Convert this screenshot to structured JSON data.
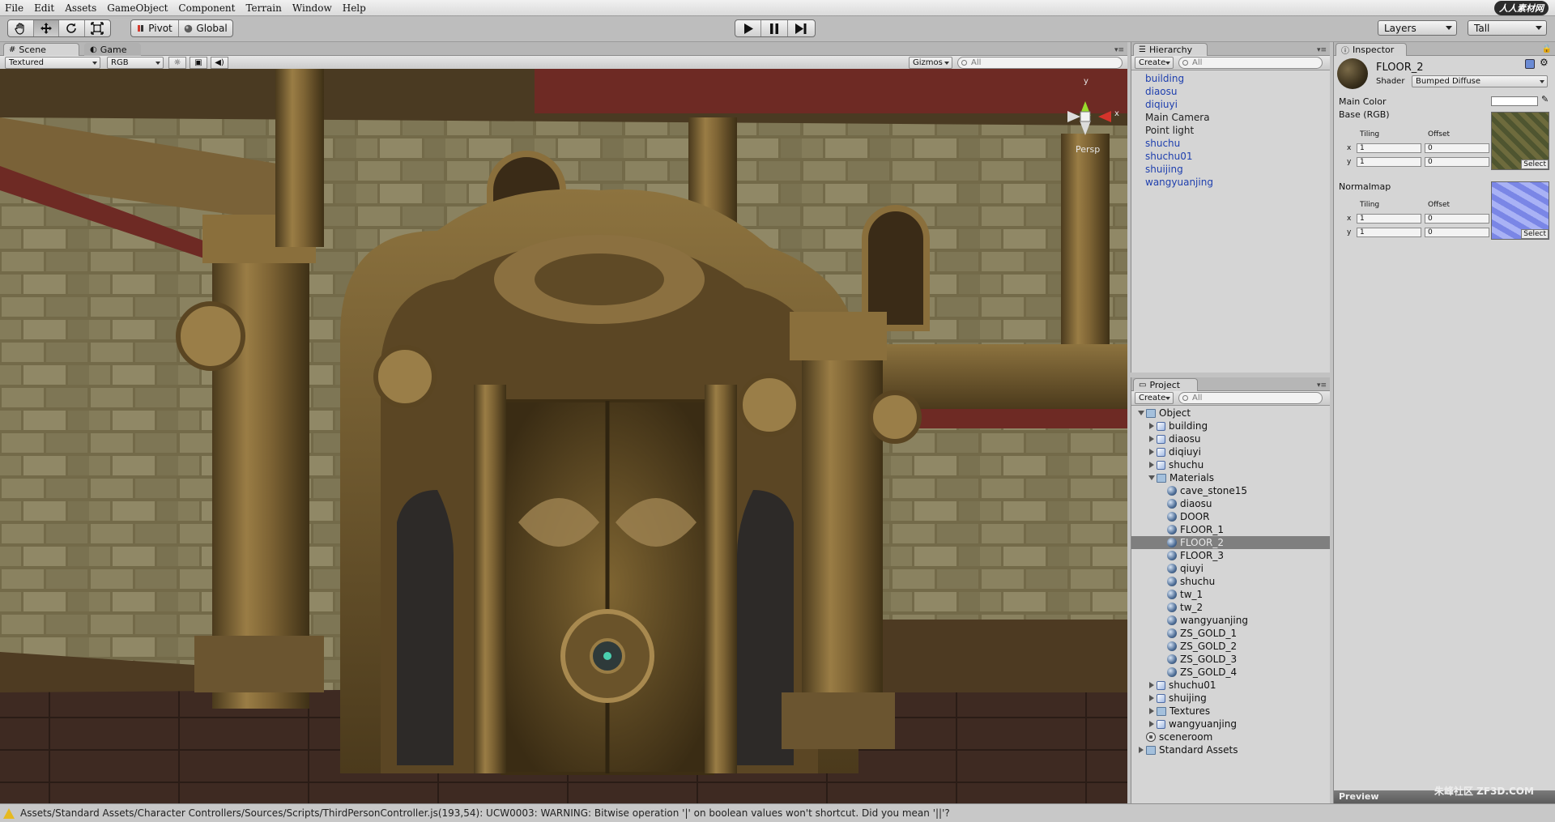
{
  "menu": [
    "File",
    "Edit",
    "Assets",
    "GameObject",
    "Component",
    "Terrain",
    "Window",
    "Help"
  ],
  "logo": "人人素材网",
  "toolbar": {
    "pivot_label": "Pivot",
    "global_label": "Global",
    "layers_label": "Layers",
    "layout_label": "Tall"
  },
  "scene": {
    "tab_scene": "Scene",
    "tab_game": "Game",
    "render_mode": "Textured",
    "color_mode": "RGB",
    "gizmos_label": "Gizmos",
    "search_placeholder": "All",
    "persp_label": "Persp",
    "gizmo_y": "y",
    "gizmo_x": "x"
  },
  "hierarchy": {
    "title": "Hierarchy",
    "create_label": "Create",
    "search_placeholder": "All",
    "items": [
      {
        "label": "building",
        "prefab": true
      },
      {
        "label": "diaosu",
        "prefab": true
      },
      {
        "label": "diqiuyi",
        "prefab": true
      },
      {
        "label": "Main Camera",
        "prefab": false
      },
      {
        "label": "Point light",
        "prefab": false
      },
      {
        "label": "shuchu",
        "prefab": true
      },
      {
        "label": "shuchu01",
        "prefab": true
      },
      {
        "label": "shuijing",
        "prefab": true
      },
      {
        "label": "wangyuanjing",
        "prefab": true
      }
    ]
  },
  "project": {
    "title": "Project",
    "create_label": "Create",
    "search_placeholder": "All",
    "items": [
      {
        "label": "Object",
        "level": 0,
        "type": "folder",
        "expand": "down"
      },
      {
        "label": "building",
        "level": 1,
        "type": "prefab",
        "expand": "right"
      },
      {
        "label": "diaosu",
        "level": 1,
        "type": "prefab",
        "expand": "right"
      },
      {
        "label": "diqiuyi",
        "level": 1,
        "type": "prefab",
        "expand": "right"
      },
      {
        "label": "shuchu",
        "level": 1,
        "type": "prefab",
        "expand": "right"
      },
      {
        "label": "Materials",
        "level": 1,
        "type": "folder",
        "expand": "down"
      },
      {
        "label": "cave_stone15",
        "level": 2,
        "type": "mat"
      },
      {
        "label": "diaosu",
        "level": 2,
        "type": "mat"
      },
      {
        "label": "DOOR",
        "level": 2,
        "type": "mat"
      },
      {
        "label": "FLOOR_1",
        "level": 2,
        "type": "mat"
      },
      {
        "label": "FLOOR_2",
        "level": 2,
        "type": "mat",
        "selected": true
      },
      {
        "label": "FLOOR_3",
        "level": 2,
        "type": "mat"
      },
      {
        "label": "qiuyi",
        "level": 2,
        "type": "mat"
      },
      {
        "label": "shuchu",
        "level": 2,
        "type": "mat"
      },
      {
        "label": "tw_1",
        "level": 2,
        "type": "mat"
      },
      {
        "label": "tw_2",
        "level": 2,
        "type": "mat"
      },
      {
        "label": "wangyuanjing",
        "level": 2,
        "type": "mat"
      },
      {
        "label": "ZS_GOLD_1",
        "level": 2,
        "type": "mat"
      },
      {
        "label": "ZS_GOLD_2",
        "level": 2,
        "type": "mat"
      },
      {
        "label": "ZS_GOLD_3",
        "level": 2,
        "type": "mat"
      },
      {
        "label": "ZS_GOLD_4",
        "level": 2,
        "type": "mat"
      },
      {
        "label": "shuchu01",
        "level": 1,
        "type": "prefab",
        "expand": "right"
      },
      {
        "label": "shuijing",
        "level": 1,
        "type": "prefab",
        "expand": "right"
      },
      {
        "label": "Textures",
        "level": 1,
        "type": "folder",
        "expand": "right"
      },
      {
        "label": "wangyuanjing",
        "level": 1,
        "type": "prefab",
        "expand": "right"
      },
      {
        "label": "sceneroom",
        "level": 0,
        "type": "scene"
      },
      {
        "label": "Standard Assets",
        "level": 0,
        "type": "folder",
        "expand": "right"
      }
    ]
  },
  "inspector": {
    "title": "Inspector",
    "material_name": "FLOOR_2",
    "shader_label": "Shader",
    "shader_value": "Bumped Diffuse",
    "main_color_label": "Main Color",
    "base_label": "Base (RGB)",
    "normalmap_label": "Normalmap",
    "tiling_label": "Tiling",
    "offset_label": "Offset",
    "x_label": "x",
    "y_label": "y",
    "base_tiling_x": "1",
    "base_tiling_y": "1",
    "base_offset_x": "0",
    "base_offset_y": "0",
    "normal_tiling_x": "1",
    "normal_tiling_y": "1",
    "normal_offset_x": "0",
    "normal_offset_y": "0",
    "select_label": "Select",
    "preview_label": "Preview",
    "watermark": "朱峰社区 ZF3D.COM"
  },
  "status": {
    "message": "Assets/Standard Assets/Character Controllers/Sources/Scripts/ThirdPersonController.js(193,54): UCW0003: WARNING: Bitwise operation '|' on boolean values won't shortcut. Did you mean '||'?"
  },
  "colors": {
    "prefab_text": "#1e3fae",
    "selection": "#7f7f7f",
    "warning": "#e6b91f"
  }
}
